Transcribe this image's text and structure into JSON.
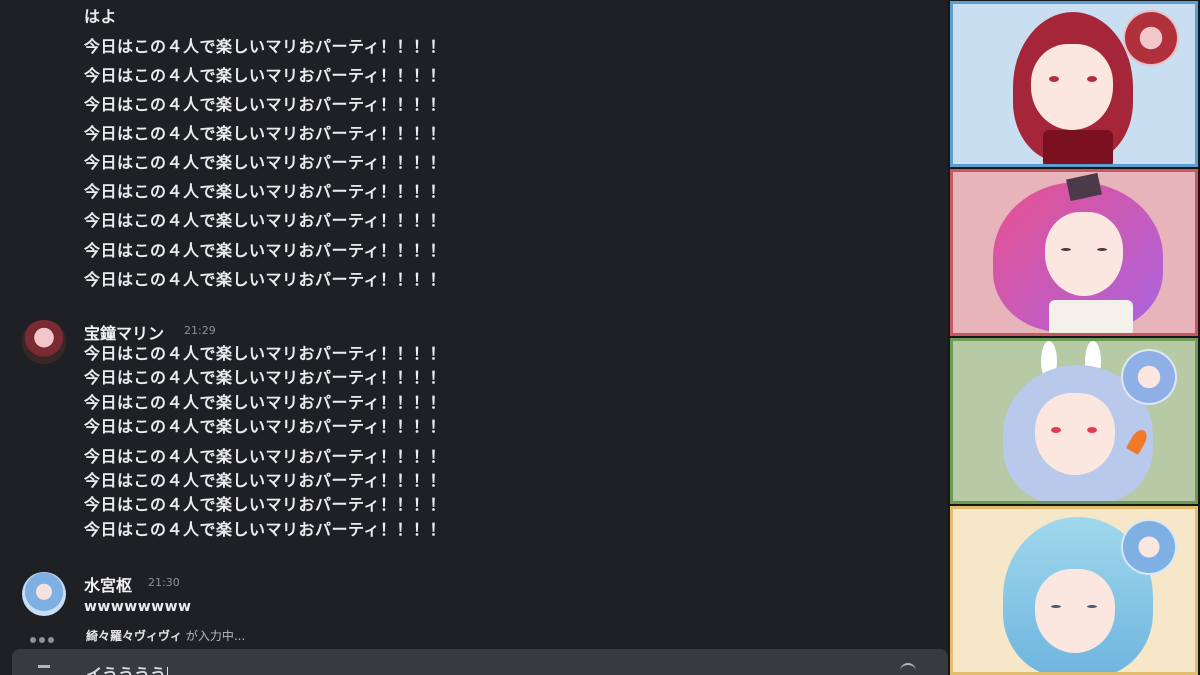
{
  "chat": {
    "top_message": {
      "partial_line": "はよ",
      "lines": [
        "今日はこの４人で楽しいマリおパーティ！！！！",
        "今日はこの４人で楽しいマリおパーティ！！！！",
        "今日はこの４人で楽しいマリおパーティ！！！！",
        "今日はこの４人で楽しいマリおパーティ！！！！",
        "今日はこの４人で楽しいマリおパーティ！！！！",
        "今日はこの４人で楽しいマリおパーティ！！！！",
        "今日はこの４人で楽しいマリおパーティ！！！！",
        "今日はこの４人で楽しいマリおパーティ！！！！",
        "今日はこの４人で楽しいマリおパーティ！！！！"
      ]
    },
    "message_marine": {
      "author": "宝鐘マリン",
      "time": "21:29",
      "lines": [
        "今日はこの４人で楽しいマリおパーティ！！！！",
        "今日はこの４人で楽しいマリおパーティ！！！！",
        "今日はこの４人で楽しいマリおパーティ！！！！",
        "今日はこの４人で楽しいマリおパーティ！！！！",
        "今日はこの４人で楽しいマリおパーティ！！！！",
        "今日はこの４人で楽しいマリおパーティ！！！！",
        "今日はこの４人で楽しいマリおパーティ！！！！",
        "今日はこの４人で楽しいマリおパーティ！！！！"
      ]
    },
    "message_suisei": {
      "author": "水宮枢",
      "time": "21:30",
      "text": "wwwwwwww"
    },
    "typing": {
      "user": "綺々羅々ヴィヴィ",
      "suffix": " が入力中..."
    },
    "input": {
      "value": "イうううう"
    }
  },
  "colors": {
    "cam1_border": "#5a9fd0",
    "cam2_border": "#c9575f",
    "cam3_border": "#6d9a57",
    "cam4_border": "#e2bd6d"
  }
}
